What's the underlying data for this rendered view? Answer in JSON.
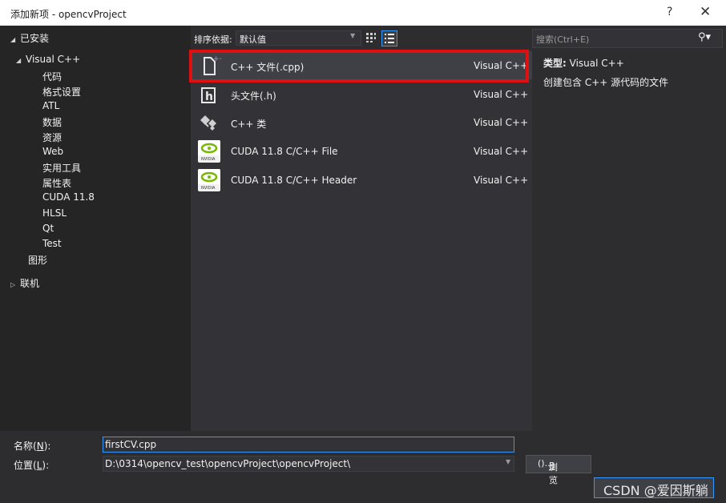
{
  "window": {
    "title": "添加新项 - opencvProject",
    "help": "?",
    "close": "✕"
  },
  "tree": {
    "installed": "已安装",
    "visual_cpp": "Visual C++",
    "children": [
      "代码",
      "格式设置",
      "ATL",
      "数据",
      "资源",
      "Web",
      "实用工具",
      "属性表",
      "CUDA 11.8",
      "HLSL",
      "Qt",
      "Test"
    ],
    "graphics": "图形",
    "online": "联机"
  },
  "toolbar": {
    "sort_label": "排序依据:",
    "sort_value": "默认值"
  },
  "templates": [
    {
      "label": "C++ 文件(.cpp)",
      "lang": "Visual C++",
      "icon": "cpp-file-icon",
      "selected": true
    },
    {
      "label": "头文件(.h)",
      "lang": "Visual C++",
      "icon": "header-file-icon"
    },
    {
      "label": "C++ 类",
      "lang": "Visual C++",
      "icon": "cpp-class-icon"
    },
    {
      "label": "CUDA 11.8 C/C++ File",
      "lang": "Visual C++",
      "icon": "nvidia-icon"
    },
    {
      "label": "CUDA 11.8 C/C++ Header",
      "lang": "Visual C++",
      "icon": "nvidia-icon"
    }
  ],
  "details": {
    "search_placeholder": "搜索(Ctrl+E)",
    "type_label": "类型:",
    "type_value": "Visual C++",
    "description": "创建包含 C++ 源代码的文件"
  },
  "form": {
    "name_label": "名称",
    "name_key": "N",
    "name_value": "firstCV.cpp",
    "location_label": "位置",
    "location_key": "L",
    "location_value": "D:\\0314\\opencv_test\\opencvProject\\opencvProject\\",
    "browse_label": "浏览",
    "browse_key": "B"
  },
  "watermark": "CSDN @爱因斯躺",
  "colors": {
    "accent": "#3399ff",
    "highlight": "#e01010",
    "nvidia": "#76b900"
  }
}
